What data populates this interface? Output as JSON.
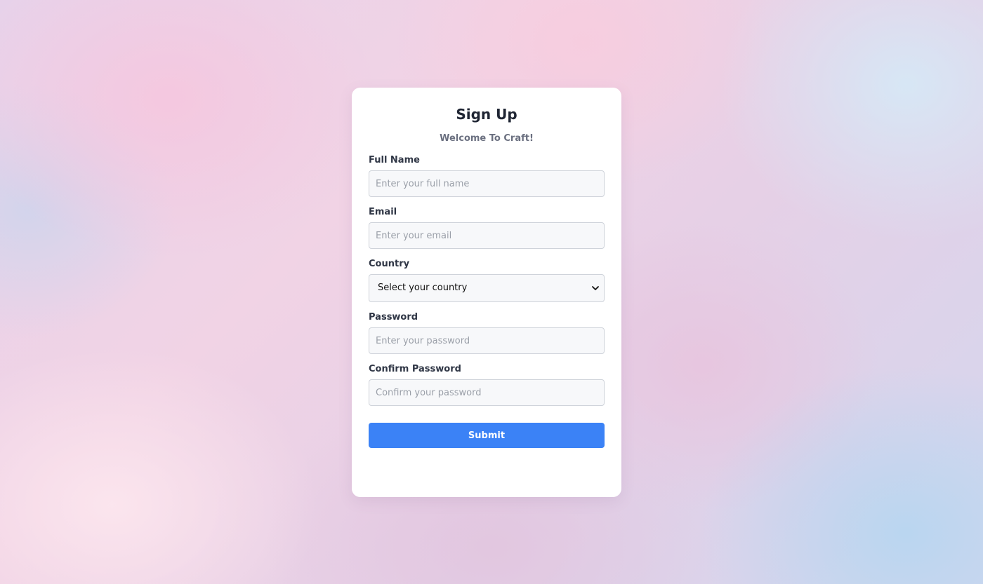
{
  "form": {
    "title": "Sign Up",
    "subtitle": "Welcome To Craft!",
    "fields": {
      "full_name": {
        "label": "Full Name",
        "placeholder": "Enter your full name",
        "value": ""
      },
      "email": {
        "label": "Email",
        "placeholder": "Enter your email",
        "value": ""
      },
      "country": {
        "label": "Country",
        "selected": "Select your country"
      },
      "password": {
        "label": "Password",
        "placeholder": "Enter your password",
        "value": ""
      },
      "confirm_password": {
        "label": "Confirm Password",
        "placeholder": "Confirm your password",
        "value": ""
      }
    },
    "submit_label": "Submit"
  },
  "icons": {
    "country_dropdown": "chevron-down-icon"
  },
  "colors": {
    "submit_button": "#3b82f6",
    "title_text": "#1f2533",
    "subtitle_text": "#6b7080"
  }
}
